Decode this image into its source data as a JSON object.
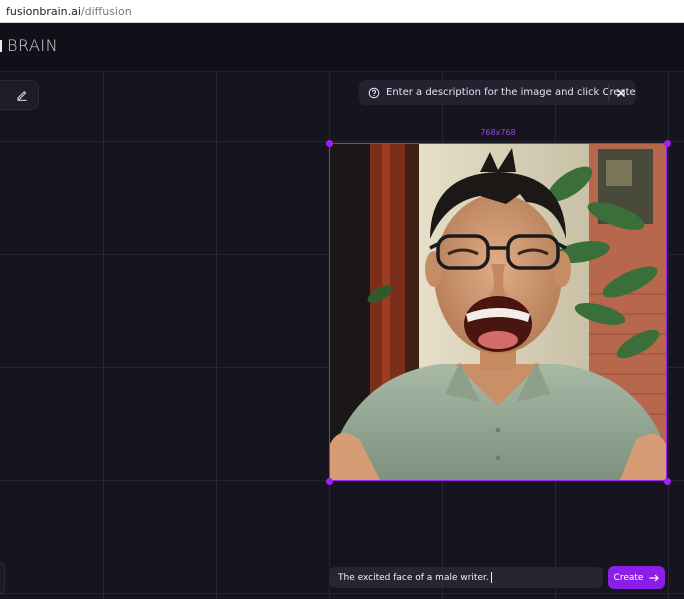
{
  "browser": {
    "url_host": "fusionbrain.ai",
    "url_path": "/diffusion"
  },
  "header": {
    "logo_text": "BRAIN"
  },
  "hint": {
    "text": "Enter a description for the image and click Create"
  },
  "canvas": {
    "size_label": "768x768"
  },
  "prompt": {
    "value": "The excited face of a male writer."
  },
  "actions": {
    "create_label": "Create"
  },
  "colors": {
    "accent": "#a020f0",
    "button": "#8b1ee8",
    "background": "#16151f"
  },
  "icons": {
    "edit": "pencil-icon",
    "help": "question-circle-icon",
    "close": "close-icon",
    "arrow": "arrow-right-icon"
  }
}
